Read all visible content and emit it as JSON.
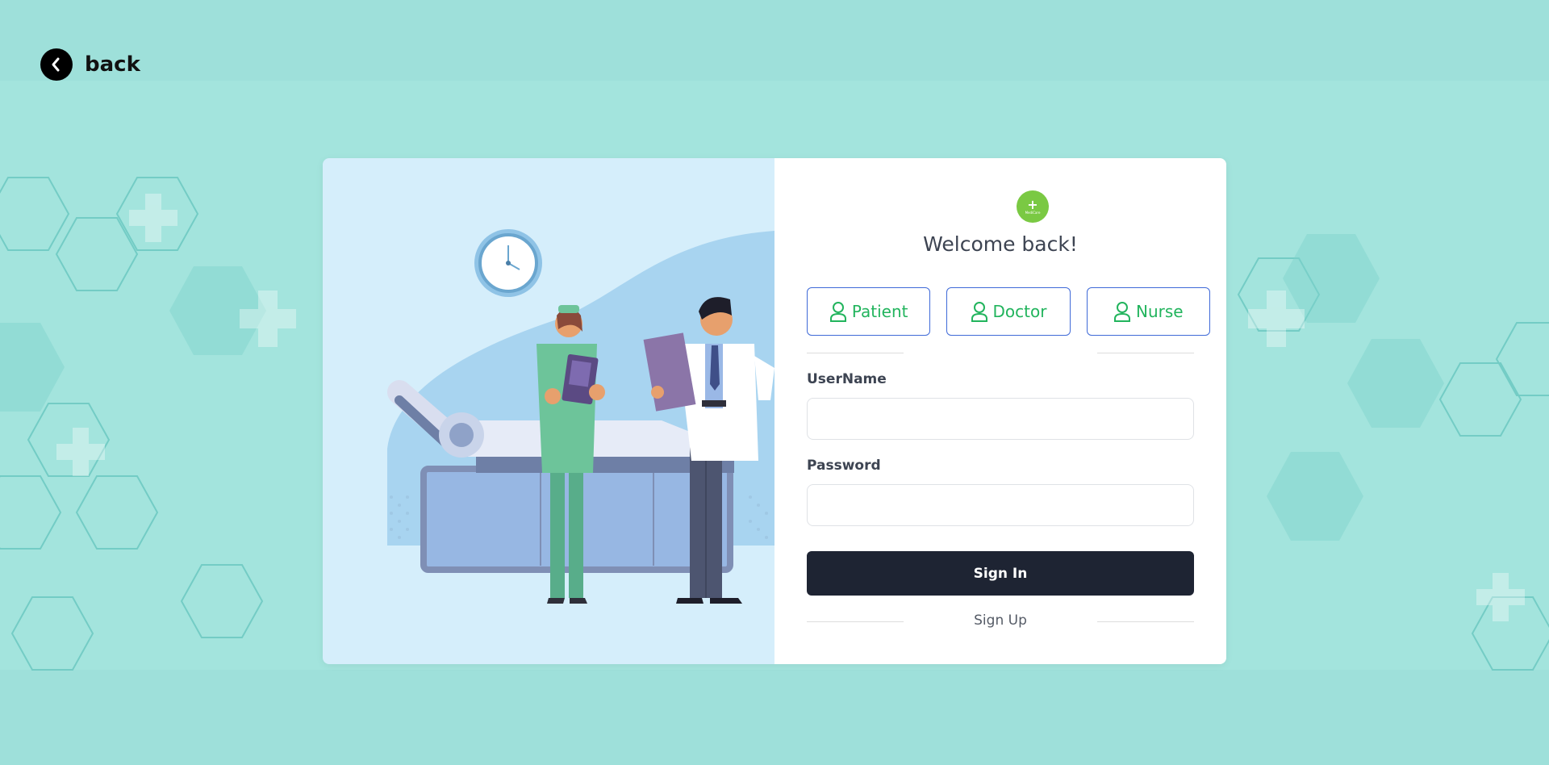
{
  "nav": {
    "back_label": "back"
  },
  "form": {
    "title": "Welcome back!",
    "roles": [
      {
        "label": "Patient",
        "icon": "user-icon"
      },
      {
        "label": "Doctor",
        "icon": "user-icon"
      },
      {
        "label": "Nurse",
        "icon": "user-icon"
      }
    ],
    "username_label": "UserName",
    "username_value": "",
    "password_label": "Password",
    "password_value": "",
    "signin_label": "Sign In",
    "signup_label": "Sign Up"
  },
  "logo": {
    "text": "MediCare"
  },
  "colors": {
    "accent_green": "#22b45d",
    "role_border": "#3f6ad8",
    "primary_button": "#1e2433",
    "logo_green": "#7ac943",
    "background_teal": "#9ee0da"
  }
}
